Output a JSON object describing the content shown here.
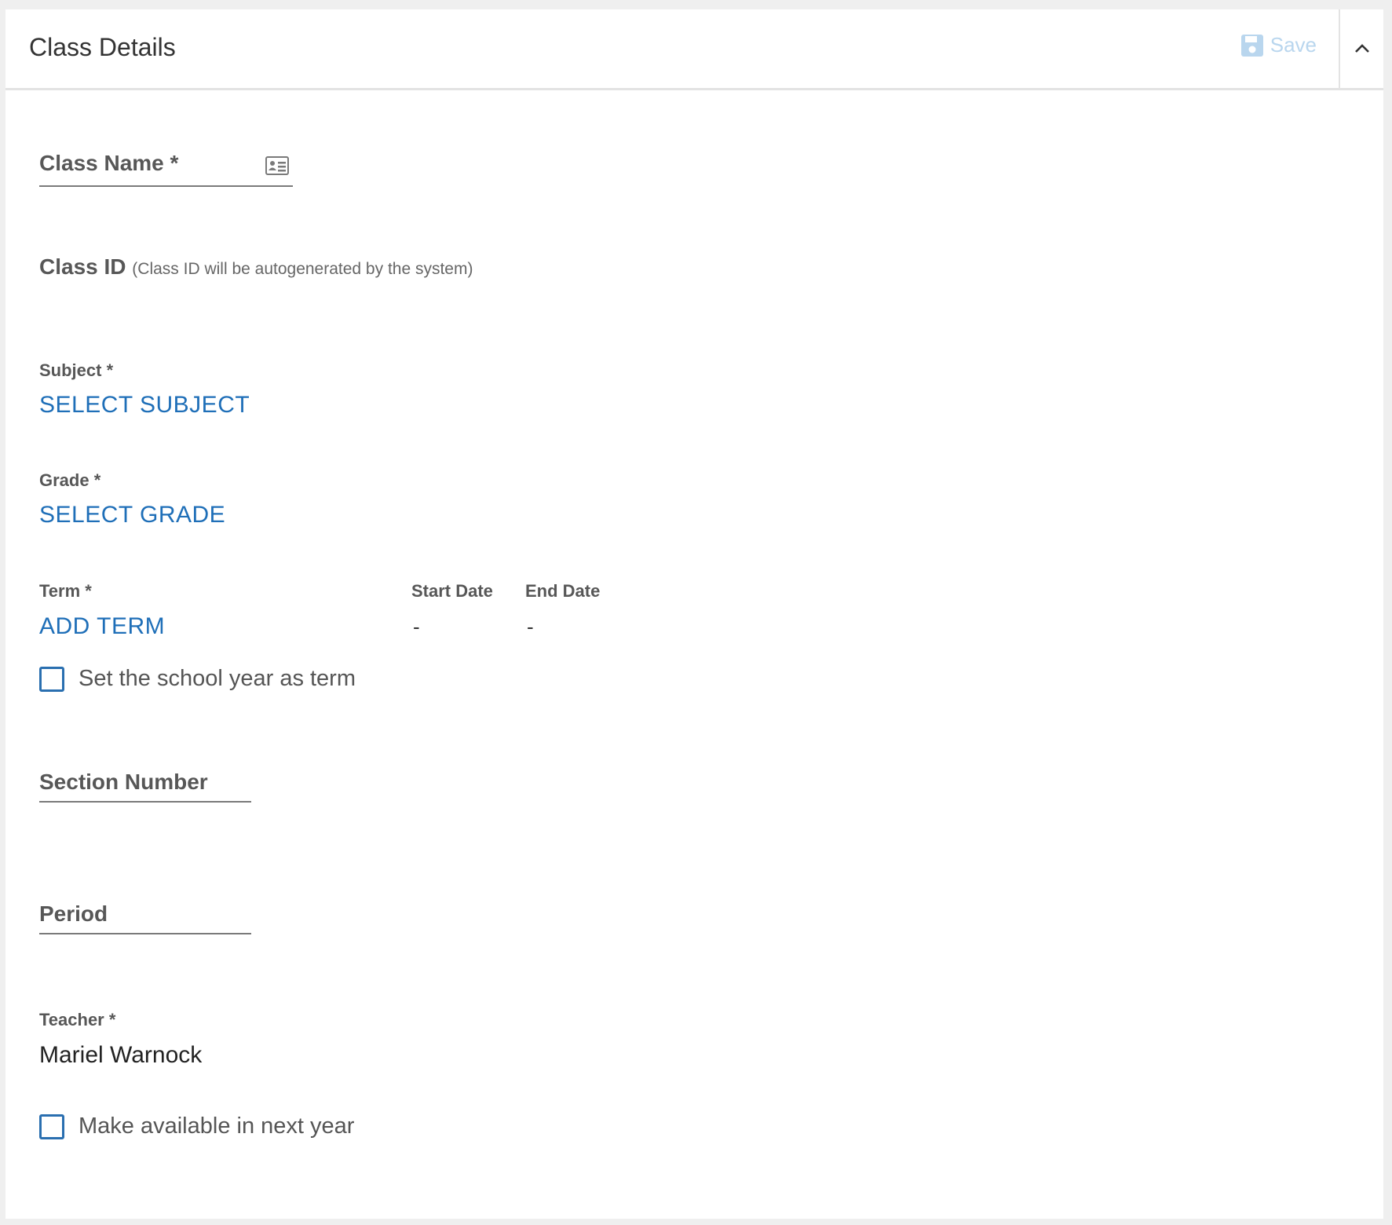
{
  "header": {
    "title": "Class Details",
    "save_label": "Save",
    "save_icon": "floppy-disk-icon",
    "collapse_icon": "chevron-up-icon"
  },
  "form": {
    "class_name": {
      "label": "Class Name *",
      "icon": "id-card-icon"
    },
    "class_id": {
      "label": "Class ID",
      "hint": "(Class ID will be autogenerated by the system)"
    },
    "subject": {
      "label": "Subject  *",
      "action": "SELECT SUBJECT"
    },
    "grade": {
      "label": "Grade  *",
      "action": "SELECT GRADE"
    },
    "term": {
      "label": "Term  *",
      "action": "ADD TERM",
      "start_date_label": "Start Date",
      "end_date_label": "End Date",
      "start_date_value": "-",
      "end_date_value": "-"
    },
    "school_year_checkbox": {
      "label": "Set the school year as term",
      "checked": false
    },
    "section_number": {
      "label": "Section Number"
    },
    "period": {
      "label": "Period"
    },
    "teacher": {
      "label": "Teacher  *",
      "value": "Mariel Warnock"
    },
    "next_year_checkbox": {
      "label": "Make available in next year",
      "checked": false
    }
  },
  "colors": {
    "link": "#1f6fb8",
    "save_disabled": "#b9d6ee",
    "checkbox_border": "#2a6fb0"
  }
}
